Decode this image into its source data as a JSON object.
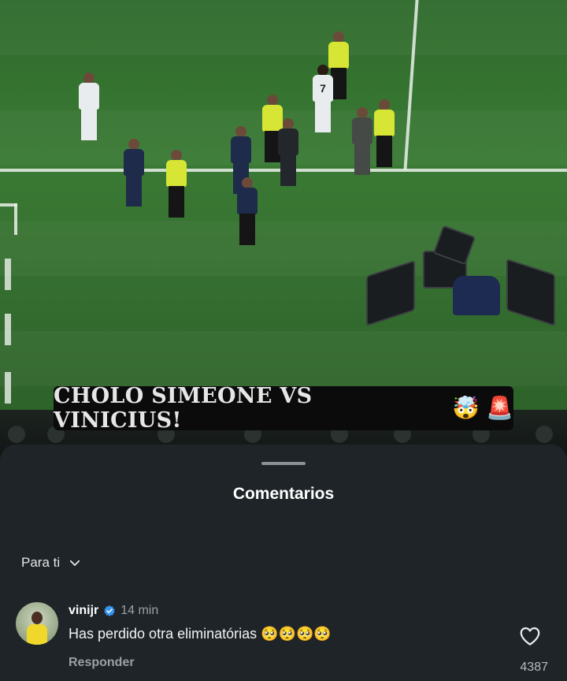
{
  "video": {
    "caption": "CHOLO SIMEONE VS VINICIUS!",
    "caption_emojis": [
      "🤯",
      "🚨"
    ],
    "jersey_number": "7"
  },
  "sheet": {
    "title": "Comentarios",
    "filter_label": "Para ti"
  },
  "comments": [
    {
      "username": "vinijr",
      "verified": true,
      "time": "14 min",
      "text": "Has perdido otra eliminatórias 🥺🥺🥺🥺",
      "reply_label": "Responder",
      "like_count": "4387"
    }
  ],
  "colors": {
    "sheet_bg": "#1e2428",
    "verified": "#3797f0"
  }
}
